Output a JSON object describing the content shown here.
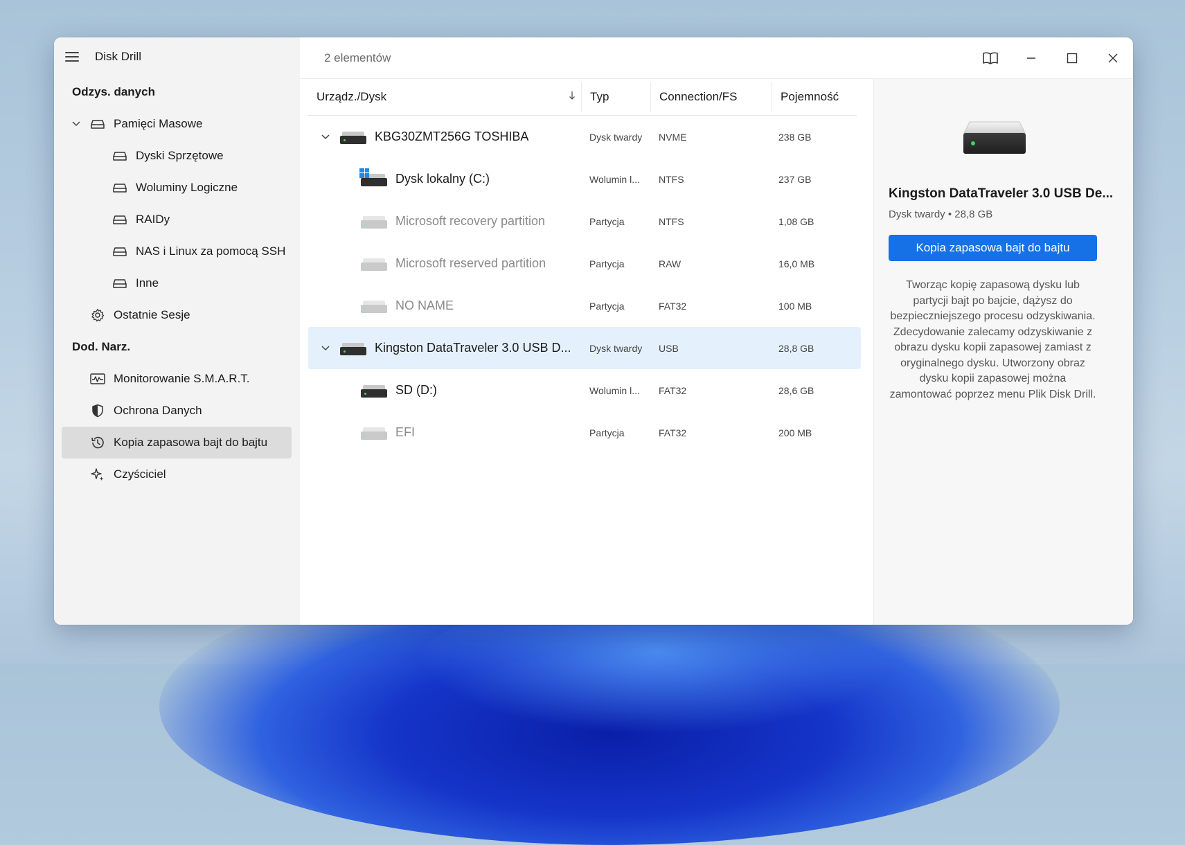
{
  "app": {
    "title": "Disk Drill"
  },
  "sidebar": {
    "section_recovery": "Odzys. danych",
    "mass_storage": "Pamięci Masowe",
    "storage_items": [
      {
        "label": "Dyski Sprzętowe"
      },
      {
        "label": "Woluminy Logiczne"
      },
      {
        "label": "RAIDy"
      },
      {
        "label": "NAS i Linux za pomocą SSH"
      },
      {
        "label": "Inne"
      }
    ],
    "recent_sessions": "Ostatnie Sesje",
    "section_tools": "Dod. Narz.",
    "tools": [
      {
        "label": "Monitorowanie S.M.A.R.T."
      },
      {
        "label": "Ochrona Danych"
      },
      {
        "label": "Kopia zapasowa bajt do bajtu"
      },
      {
        "label": "Czyściciel"
      }
    ]
  },
  "topbar": {
    "item_count": "2 elementów"
  },
  "table": {
    "columns": {
      "device": "Urządz./Dysk",
      "type": "Typ",
      "connection": "Connection/FS",
      "capacity": "Pojemność"
    },
    "rows": [
      {
        "name": "KBG30ZMT256G TOSHIBA",
        "type": "Dysk twardy",
        "conn": "NVME",
        "cap": "238 GB"
      },
      {
        "name": "Dysk lokalny (C:)",
        "type": "Wolumin l...",
        "conn": "NTFS",
        "cap": "237 GB"
      },
      {
        "name": "Microsoft recovery partition",
        "type": "Partycja",
        "conn": "NTFS",
        "cap": "1,08 GB"
      },
      {
        "name": "Microsoft reserved partition",
        "type": "Partycja",
        "conn": "RAW",
        "cap": "16,0 MB"
      },
      {
        "name": "NO NAME",
        "type": "Partycja",
        "conn": "FAT32",
        "cap": "100 MB"
      },
      {
        "name": "Kingston DataTraveler 3.0 USB D...",
        "type": "Dysk twardy",
        "conn": "USB",
        "cap": "28,8 GB"
      },
      {
        "name": "SD (D:)",
        "type": "Wolumin l...",
        "conn": "FAT32",
        "cap": "28,6 GB"
      },
      {
        "name": "EFI",
        "type": "Partycja",
        "conn": "FAT32",
        "cap": "200 MB"
      }
    ]
  },
  "detail": {
    "title": "Kingston DataTraveler 3.0 USB De...",
    "subtitle": "Dysk twardy • 28,8 GB",
    "button": "Kopia zapasowa bajt do bajtu",
    "description": "Tworząc kopię zapasową dysku lub partycji bajt po bajcie, dążysz do bezpieczniejszego procesu odzyskiwania. Zdecydowanie zalecamy odzyskiwanie z obrazu dysku kopii zapasowej zamiast z oryginalnego dysku. Utworzony obraz dysku kopii zapasowej można zamontować poprzez menu Plik Disk Drill."
  },
  "colors": {
    "accent": "#1671e6",
    "selected_row": "#e4f1fc",
    "sidebar_bg": "#f3f3f3",
    "active_nav": "#dcdcdc"
  },
  "icons": [
    "menu-icon",
    "hdd-icon",
    "clock-gear-icon",
    "smart-monitor-icon",
    "shield-icon",
    "history-icon",
    "sparkle-icon",
    "book-icon",
    "minimize-icon",
    "maximize-icon",
    "close-icon",
    "sort-down-icon",
    "chevron-down-icon",
    "windows-logo-icon"
  ]
}
